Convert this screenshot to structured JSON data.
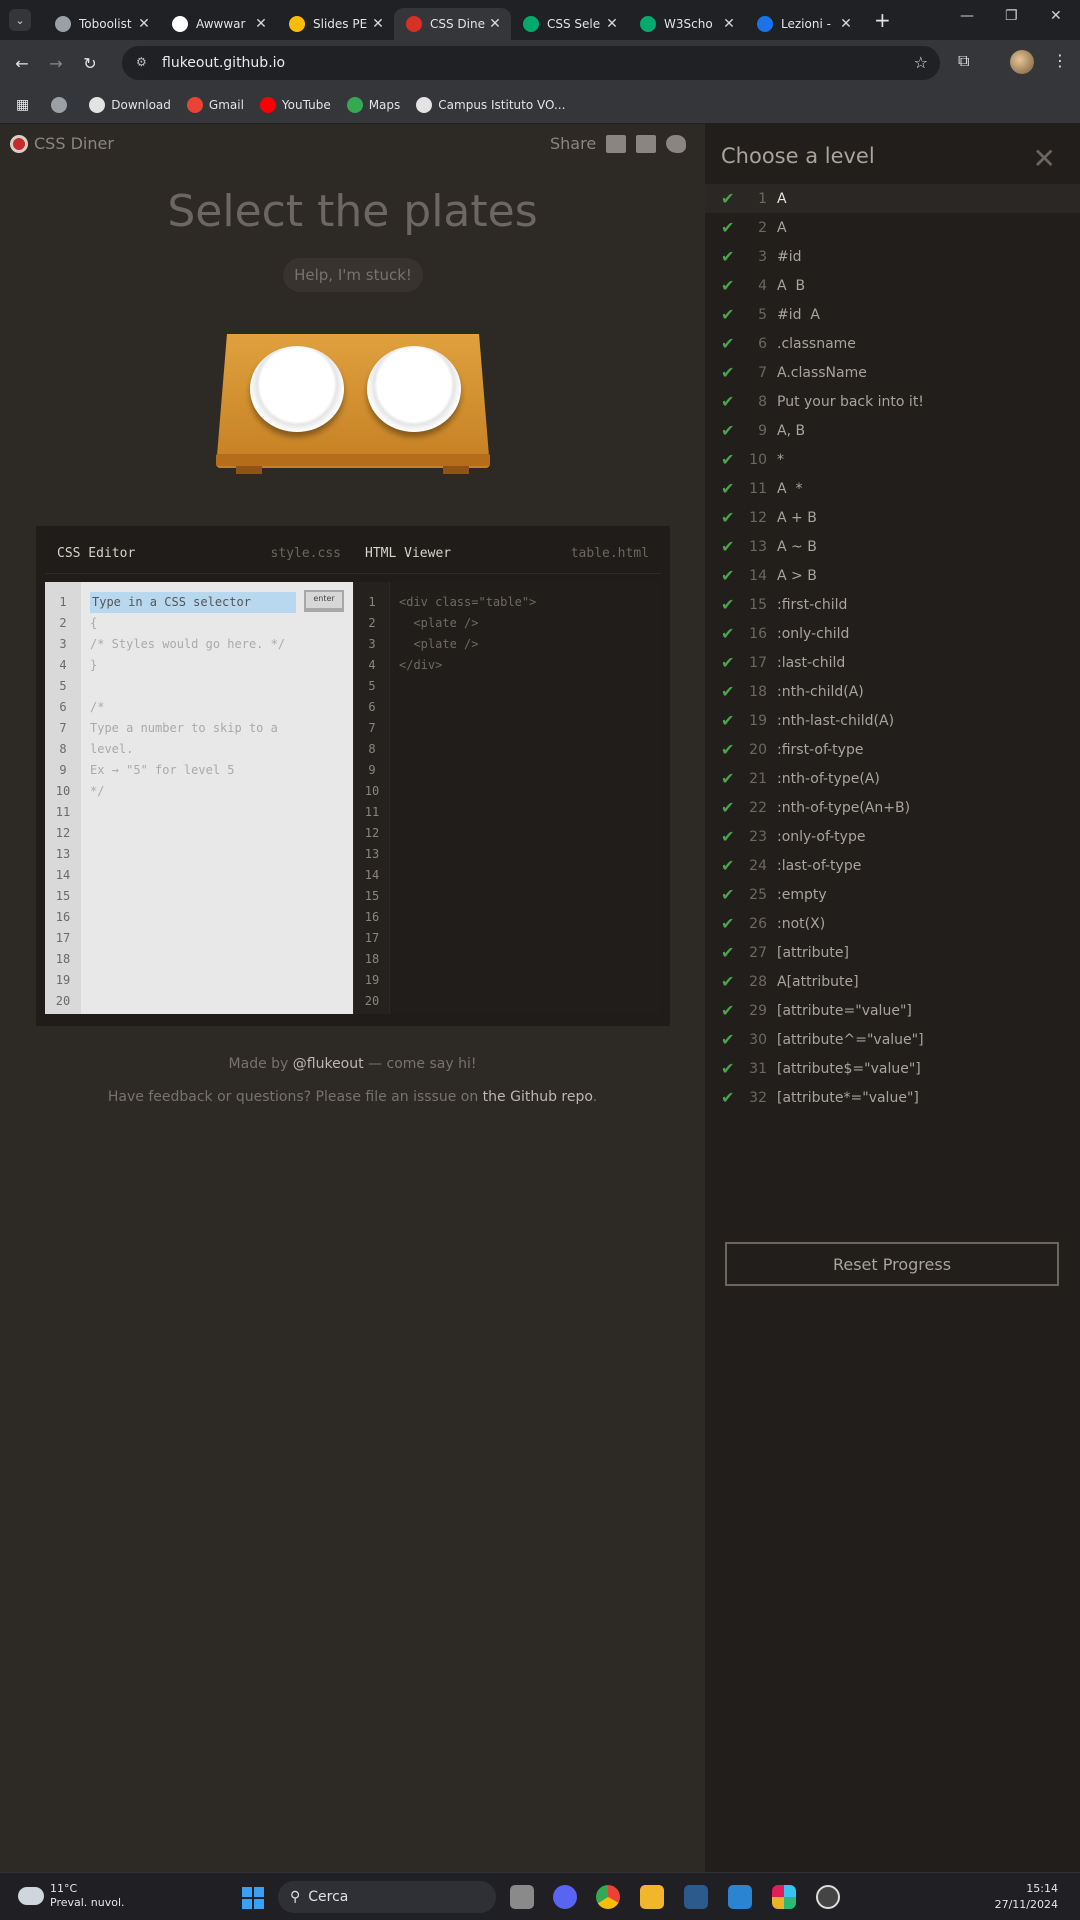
{
  "browser": {
    "tabs": [
      {
        "title": "Toboolist",
        "icon": "globe-icon",
        "active": false
      },
      {
        "title": "Awwwar",
        "icon": "awwwards-icon",
        "active": false
      },
      {
        "title": "Slides PE",
        "icon": "drive-icon",
        "active": false
      },
      {
        "title": "CSS Dine",
        "icon": "css-diner-icon",
        "active": true
      },
      {
        "title": "CSS Sele",
        "icon": "w3schools-icon",
        "active": false
      },
      {
        "title": "W3Scho",
        "icon": "w3schools-icon",
        "active": false
      },
      {
        "title": "Lezioni -",
        "icon": "lezioni-icon",
        "active": false
      }
    ],
    "url": "flukeout.github.io",
    "bookmarks": [
      {
        "label": "",
        "icon": "globe-icon"
      },
      {
        "label": "Download",
        "icon": "download-icon"
      },
      {
        "label": "Gmail",
        "icon": "gmail-icon"
      },
      {
        "label": "YouTube",
        "icon": "youtube-icon"
      },
      {
        "label": "Maps",
        "icon": "maps-icon"
      },
      {
        "label": "Campus Istituto VO...",
        "icon": "campus-icon"
      }
    ]
  },
  "app": {
    "logo_text": "CSS Diner",
    "share_label": "Share",
    "level_title": "Select the plates",
    "help_button": "Help, I'm stuck!",
    "css_editor": {
      "title": "CSS Editor",
      "file": "style.css",
      "input_placeholder": "Type in a CSS selector",
      "enter_label": "enter",
      "code": "\n{\n/* Styles would go here. */\n}\n\n/*\nType a number to skip to a\nlevel.\nEx → \"5\" for level 5\n*/"
    },
    "html_viewer": {
      "title": "HTML Viewer",
      "file": "table.html",
      "code": "<div class=\"table\">\n  <plate />\n  <plate />\n</div>"
    },
    "line_numbers": "1\n2\n3\n4\n5\n6\n7\n8\n9\n10\n11\n12\n13\n14\n15\n16\n17\n18\n19\n20",
    "credits": {
      "prefix": "Made by ",
      "link": "@flukeout",
      "suffix": " — come say hi!"
    },
    "feedback": {
      "prefix": "Have feedback or questions? Please file an isssue on ",
      "link": "the Github repo",
      "suffix": "."
    }
  },
  "sidebar": {
    "title": "Choose a level",
    "current_level": 1,
    "levels": [
      {
        "num": "1",
        "name": "A"
      },
      {
        "num": "2",
        "name": "A"
      },
      {
        "num": "3",
        "name": "#id"
      },
      {
        "num": "4",
        "name": "A  B"
      },
      {
        "num": "5",
        "name": "#id  A"
      },
      {
        "num": "6",
        "name": ".classname"
      },
      {
        "num": "7",
        "name": "A.className"
      },
      {
        "num": "8",
        "name": "Put your back into it!"
      },
      {
        "num": "9",
        "name": "A, B"
      },
      {
        "num": "10",
        "name": "*"
      },
      {
        "num": "11",
        "name": "A  *"
      },
      {
        "num": "12",
        "name": "A + B"
      },
      {
        "num": "13",
        "name": "A ~ B"
      },
      {
        "num": "14",
        "name": "A > B"
      },
      {
        "num": "15",
        "name": ":first-child"
      },
      {
        "num": "16",
        "name": ":only-child"
      },
      {
        "num": "17",
        "name": ":last-child"
      },
      {
        "num": "18",
        "name": ":nth-child(A)"
      },
      {
        "num": "19",
        "name": ":nth-last-child(A)"
      },
      {
        "num": "20",
        "name": ":first-of-type"
      },
      {
        "num": "21",
        "name": ":nth-of-type(A)"
      },
      {
        "num": "22",
        "name": ":nth-of-type(An+B)"
      },
      {
        "num": "23",
        "name": ":only-of-type"
      },
      {
        "num": "24",
        "name": ":last-of-type"
      },
      {
        "num": "25",
        "name": ":empty"
      },
      {
        "num": "26",
        "name": ":not(X)"
      },
      {
        "num": "27",
        "name": "[attribute]"
      },
      {
        "num": "28",
        "name": "A[attribute]"
      },
      {
        "num": "29",
        "name": "[attribute=\"value\"]"
      },
      {
        "num": "30",
        "name": "[attribute^=\"value\"]"
      },
      {
        "num": "31",
        "name": "[attribute$=\"value\"]"
      },
      {
        "num": "32",
        "name": "[attribute*=\"value\"]"
      }
    ],
    "reset_label": "Reset Progress"
  },
  "taskbar": {
    "temperature": "11°C",
    "weather": "Preval. nuvol.",
    "search_label": "Cerca",
    "time": "15:14",
    "date": "27/11/2024"
  }
}
